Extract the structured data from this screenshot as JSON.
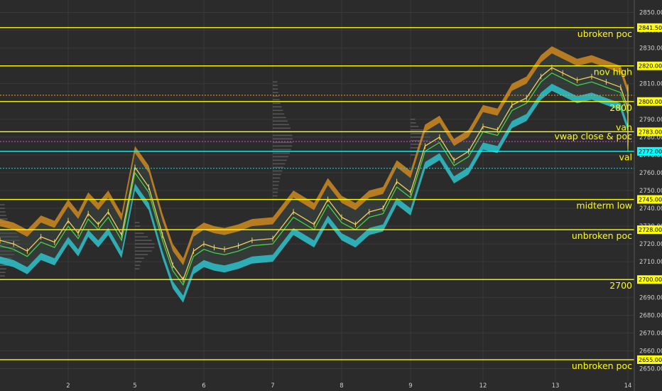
{
  "chart_data": {
    "type": "line",
    "title": "",
    "xlabel": "",
    "ylabel": "",
    "y_axis_side": "right",
    "ylim": [
      2643,
      2857
    ],
    "x_ticks": [
      "2",
      "5",
      "6",
      "7",
      "8",
      "9",
      "12",
      "13",
      "14"
    ],
    "y_ticks": [
      2650,
      2660,
      2670,
      2680,
      2690,
      2700,
      2710,
      2720,
      2730,
      2740,
      2750,
      2760,
      2770,
      2780,
      2790,
      2800,
      2810,
      2820,
      2830,
      2840,
      2850
    ],
    "levels": [
      {
        "name": "ubroken poc",
        "value": 2841.5,
        "badge": "2841.50",
        "color": "#ffff00",
        "style": "solid"
      },
      {
        "name": "nov high",
        "value": 2820.0,
        "badge": "2820.00",
        "color": "#ffff00",
        "style": "solid"
      },
      {
        "name": "2800",
        "value": 2800.0,
        "badge": "2800.00",
        "color": "#ffff00",
        "style": "solid"
      },
      {
        "name": "vah",
        "value": 2783.0,
        "badge": "2783.00",
        "color": "#ffff00",
        "style": "solid"
      },
      {
        "name": "vwap close & poc",
        "value": 2777.5,
        "badge": "",
        "color": "#ffff00",
        "style": "none"
      },
      {
        "name": "val",
        "value": 2772.0,
        "badge": "2772.00",
        "color": "#00ffff",
        "style": "solid"
      },
      {
        "name": "midterm low",
        "value": 2745.0,
        "badge": "2745.00",
        "color": "#ffff00",
        "style": "solid"
      },
      {
        "name": "unbroken poc",
        "value": 2728.0,
        "badge": "2728.00",
        "color": "#ffff00",
        "style": "solid"
      },
      {
        "name": "2700",
        "value": 2700.0,
        "badge": "2700.00",
        "color": "#ffff00",
        "style": "solid"
      },
      {
        "name": "unbroken poc",
        "value": 2655.0,
        "badge": "2655.00",
        "color": "#ffff00",
        "style": "solid"
      }
    ],
    "dotted_levels": [
      {
        "value": 2803.5,
        "color": "#ff9900"
      },
      {
        "value": 2783.0,
        "color": "#33ff66"
      },
      {
        "value": 2777.5,
        "color": "#ff33ff"
      },
      {
        "value": 2762.5,
        "color": "#33cccc"
      }
    ],
    "series": [
      {
        "name": "",
        "color": "#f0d060",
        "x": [
          0.0,
          0.2,
          0.4,
          0.6,
          0.8,
          1.0,
          1.15,
          1.3,
          1.45,
          1.6,
          1.8,
          2.0,
          2.2,
          2.4,
          2.55,
          2.7,
          2.85,
          3.0,
          3.15,
          3.3,
          3.5,
          3.7,
          4.0,
          4.3,
          4.6,
          4.8,
          5.0,
          5.2,
          5.4,
          5.6,
          5.8,
          6.0,
          6.2,
          6.4,
          6.6,
          6.8,
          7.0,
          7.2,
          7.4,
          7.6,
          7.8,
          7.95,
          8.1,
          8.3,
          8.5,
          8.7,
          8.9,
          9.0,
          9.2,
          9.4,
          9.6,
          9.8,
          9.95,
          10.05
        ],
        "y": [
          2722,
          2720,
          2716,
          2724,
          2721,
          2733,
          2726,
          2737,
          2731,
          2738,
          2725,
          2763,
          2752,
          2725,
          2708,
          2700,
          2716,
          2720,
          2718,
          2717,
          2719,
          2722,
          2723,
          2738,
          2731,
          2745,
          2735,
          2731,
          2738,
          2740,
          2755,
          2749,
          2775,
          2780,
          2767,
          2772,
          2786,
          2784,
          2798,
          2802,
          2814,
          2819,
          2816,
          2812,
          2814,
          2811,
          2808,
          2796,
          2808,
          2803,
          2801,
          2793,
          2775,
          2782
        ]
      }
    ]
  }
}
